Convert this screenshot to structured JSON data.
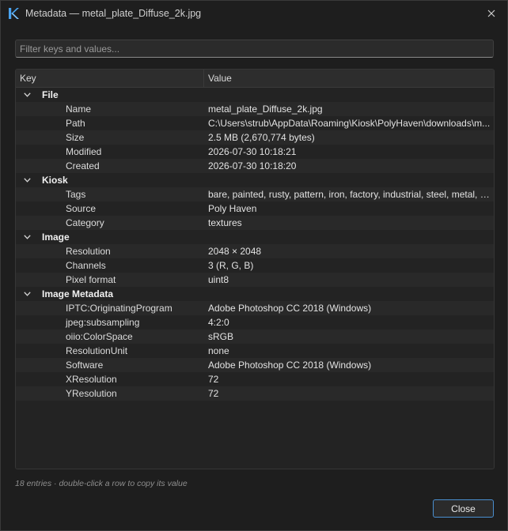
{
  "window": {
    "title": "Metadata — metal_plate_Diffuse_2k.jpg",
    "app_icon": "kiosk-logo-icon",
    "close_icon": "close-icon",
    "accent_color": "#4a8fd0"
  },
  "filter": {
    "placeholder": "Filter keys and values...",
    "value": ""
  },
  "table": {
    "headers": {
      "key": "Key",
      "value": "Value"
    },
    "groups": [
      {
        "label": "File",
        "rows": [
          {
            "key": "Name",
            "value": "metal_plate_Diffuse_2k.jpg"
          },
          {
            "key": "Path",
            "value": "C:\\Users\\strub\\AppData\\Roaming\\Kiosk\\PolyHaven\\downloads\\m..."
          },
          {
            "key": "Size",
            "value": "2.5 MB  (2,670,774 bytes)"
          },
          {
            "key": "Modified",
            "value": "2026-07-30 10:18:21"
          },
          {
            "key": "Created",
            "value": "2026-07-30 10:18:20"
          }
        ]
      },
      {
        "label": "Kiosk",
        "rows": [
          {
            "key": "Tags",
            "value": "bare, painted, rusty, pattern, iron, factory, industrial, steel, metal, fl..."
          },
          {
            "key": "Source",
            "value": "Poly Haven"
          },
          {
            "key": "Category",
            "value": "textures"
          }
        ]
      },
      {
        "label": "Image",
        "rows": [
          {
            "key": "Resolution",
            "value": "2048 × 2048"
          },
          {
            "key": "Channels",
            "value": "3  (R, G, B)"
          },
          {
            "key": "Pixel format",
            "value": "uint8"
          }
        ]
      },
      {
        "label": "Image Metadata",
        "rows": [
          {
            "key": "IPTC:OriginatingProgram",
            "value": "Adobe Photoshop CC 2018 (Windows)"
          },
          {
            "key": "jpeg:subsampling",
            "value": "4:2:0"
          },
          {
            "key": "oiio:ColorSpace",
            "value": "sRGB"
          },
          {
            "key": "ResolutionUnit",
            "value": "none"
          },
          {
            "key": "Software",
            "value": "Adobe Photoshop CC 2018 (Windows)"
          },
          {
            "key": "XResolution",
            "value": "72"
          },
          {
            "key": "YResolution",
            "value": "72"
          }
        ]
      }
    ]
  },
  "status": "18 entries · double-click a row to copy its value",
  "buttons": {
    "close": "Close"
  }
}
